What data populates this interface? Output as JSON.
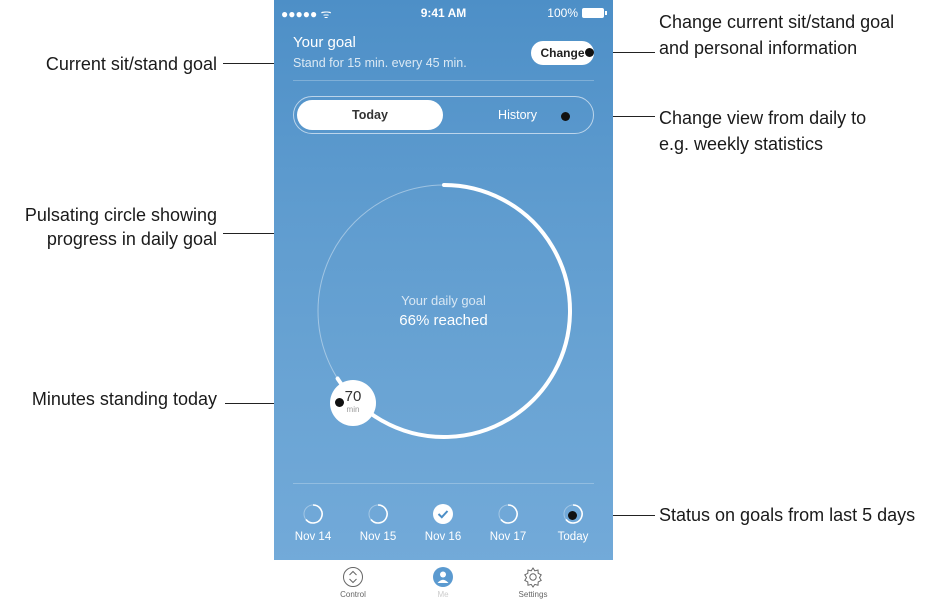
{
  "status_bar": {
    "signal": "●●●●● ᯤ",
    "time": "9:41 AM",
    "battery": "100%"
  },
  "goal": {
    "title": "Your goal",
    "subtitle": "Stand for 15 min. every 45 min."
  },
  "change_button": "Change",
  "tabs": {
    "today": "Today",
    "history": "History"
  },
  "progress": {
    "line1": "Your daily goal",
    "line2": "66% reached",
    "fraction": 0.66
  },
  "minutes": {
    "value": "70",
    "unit": "min"
  },
  "days": [
    {
      "label": "Nov 14",
      "status": "partial"
    },
    {
      "label": "Nov 15",
      "status": "partial"
    },
    {
      "label": "Nov 16",
      "status": "complete"
    },
    {
      "label": "Nov 17",
      "status": "partial"
    },
    {
      "label": "Today",
      "status": "partial"
    }
  ],
  "tab_bar": [
    {
      "label": "Control",
      "icon": "control-arrows-icon"
    },
    {
      "label": "Me",
      "icon": "person-icon",
      "active": true
    },
    {
      "label": "Settings",
      "icon": "gear-icon"
    }
  ],
  "annotations": {
    "current_goal": "Current sit/stand goal",
    "change_goal_l1": "Change current sit/stand goal",
    "change_goal_l2": "and personal information",
    "change_view_l1": "Change view from daily to",
    "change_view_l2": "e.g. weekly statistics",
    "pulsating_l1": "Pulsating circle showing",
    "pulsating_l2": "progress in daily goal",
    "minutes_standing": "Minutes standing today",
    "status_goals": "Status on goals from last 5 days"
  },
  "colors": {
    "accent": "#4d8fc7",
    "ring": "#ffffff",
    "annotation": "#1a1a1a"
  }
}
